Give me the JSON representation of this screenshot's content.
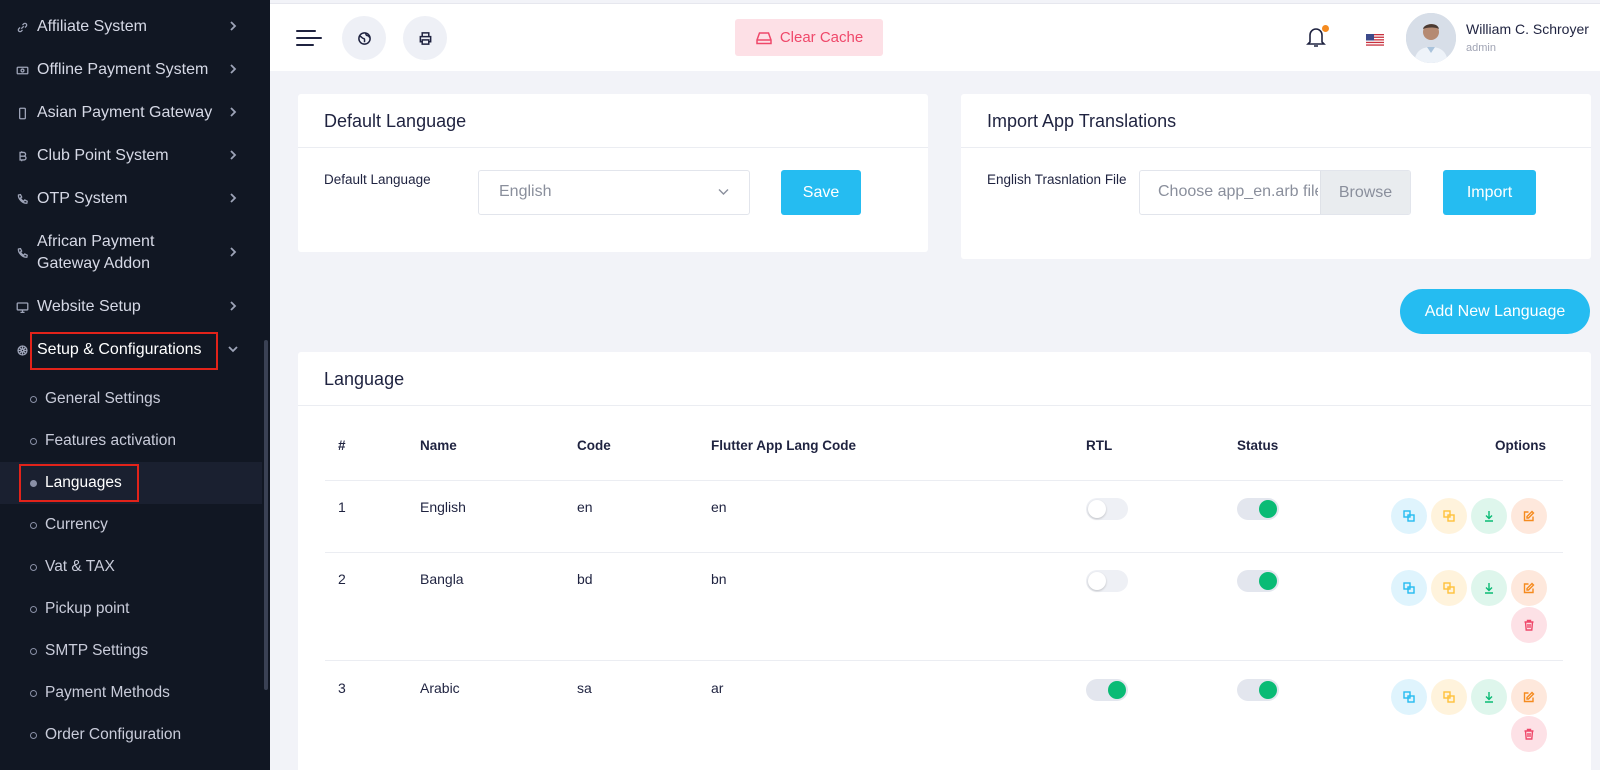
{
  "sidebar": {
    "items": [
      {
        "label": "Affiliate System",
        "icon": "link-icon"
      },
      {
        "label": "Offline Payment System",
        "icon": "money-icon"
      },
      {
        "label": "Asian Payment Gateway",
        "icon": "phone-icon"
      },
      {
        "label": "Club Point System",
        "icon": "bitcoin-icon"
      },
      {
        "label": "OTP System",
        "icon": "phone-call-icon"
      },
      {
        "label": "African Payment Gateway Addon",
        "icon": "phone-call-icon"
      },
      {
        "label": "Website Setup",
        "icon": "desktop-icon"
      },
      {
        "label": "Setup & Configurations",
        "icon": "dharmachakra-icon"
      }
    ],
    "subitems": [
      {
        "label": "General Settings"
      },
      {
        "label": "Features activation"
      },
      {
        "label": "Languages"
      },
      {
        "label": "Currency"
      },
      {
        "label": "Vat & TAX"
      },
      {
        "label": "Pickup point"
      },
      {
        "label": "SMTP Settings"
      },
      {
        "label": "Payment Methods"
      },
      {
        "label": "Order Configuration"
      }
    ]
  },
  "topbar": {
    "clear_cache_label": "Clear Cache",
    "user_name": "William C. Schroyer",
    "user_role": "admin"
  },
  "default_language_card": {
    "title": "Default Language",
    "field_label": "Default Language",
    "selected": "English",
    "save_label": "Save"
  },
  "import_card": {
    "title": "Import App Translations",
    "field_label": "English Trasnlation File",
    "file_placeholder": "Choose app_en.arb file",
    "browse_label": "Browse",
    "import_label": "Import"
  },
  "add_language_label": "Add New Language",
  "language_table": {
    "title": "Language",
    "headers": [
      "#",
      "Name",
      "Code",
      "Flutter App Lang Code",
      "RTL",
      "Status",
      "Options"
    ],
    "rows": [
      {
        "num": "1",
        "name": "English",
        "code": "en",
        "app_code": "en",
        "rtl": false,
        "status": true
      },
      {
        "num": "2",
        "name": "Bangla",
        "code": "bd",
        "app_code": "bn",
        "rtl": false,
        "status": true
      },
      {
        "num": "3",
        "name": "Arabic",
        "code": "sa",
        "app_code": "ar",
        "rtl": true,
        "status": true
      }
    ]
  },
  "colors": {
    "sidebar_bg": "#111723",
    "accent_blue": "#25bcf1",
    "toggle_on": "#0abb75",
    "highlight_red": "#e2231a"
  }
}
